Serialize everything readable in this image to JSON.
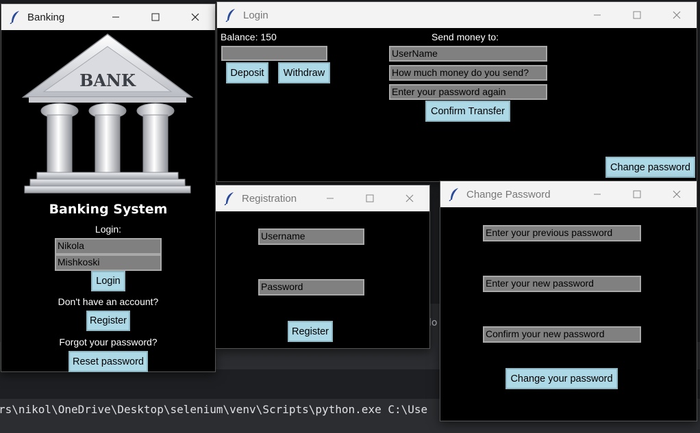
{
  "background": {
    "terminal_line": "rs\\nikol\\OneDrive\\Desktop\\selenium\\venv\\Scripts\\python.exe C:\\Use",
    "strip_text": "lo"
  },
  "banking_window": {
    "title": "Banking",
    "logo_text": "BANK",
    "heading": "Banking System",
    "login_label": "Login:",
    "username_value": "Nikola",
    "password_value": "Mishkoski",
    "login_button": "Login",
    "no_account_text": "Don't have an account?",
    "register_button": "Register",
    "forgot_text": "Forgot your password?",
    "reset_button": "Reset password"
  },
  "login_window": {
    "title": "Login",
    "balance_text": "Balance: 150",
    "amount_value": "",
    "deposit_button": "Deposit",
    "withdraw_button": "Withdraw",
    "send_money_label": "Send money to:",
    "username_field": "UserName",
    "amount_field": "How much money do you send?",
    "password_field": "Enter your password again",
    "confirm_button": "Confirm Transfer",
    "change_password_button": "Change password"
  },
  "registration_window": {
    "title": "Registration",
    "username_field": "Username",
    "password_field": "Password",
    "register_button": "Register"
  },
  "change_password_window": {
    "title": "Change Password",
    "previous_field": "Enter your previous password",
    "new_field": "Enter your new password",
    "confirm_field": "Confirm your new password",
    "submit_button": "Change your password"
  },
  "colors": {
    "button_bg": "#add8e6",
    "entry_bg": "#808080",
    "window_bg": "#000000",
    "titlebar_bg": "#f3f3f3"
  }
}
